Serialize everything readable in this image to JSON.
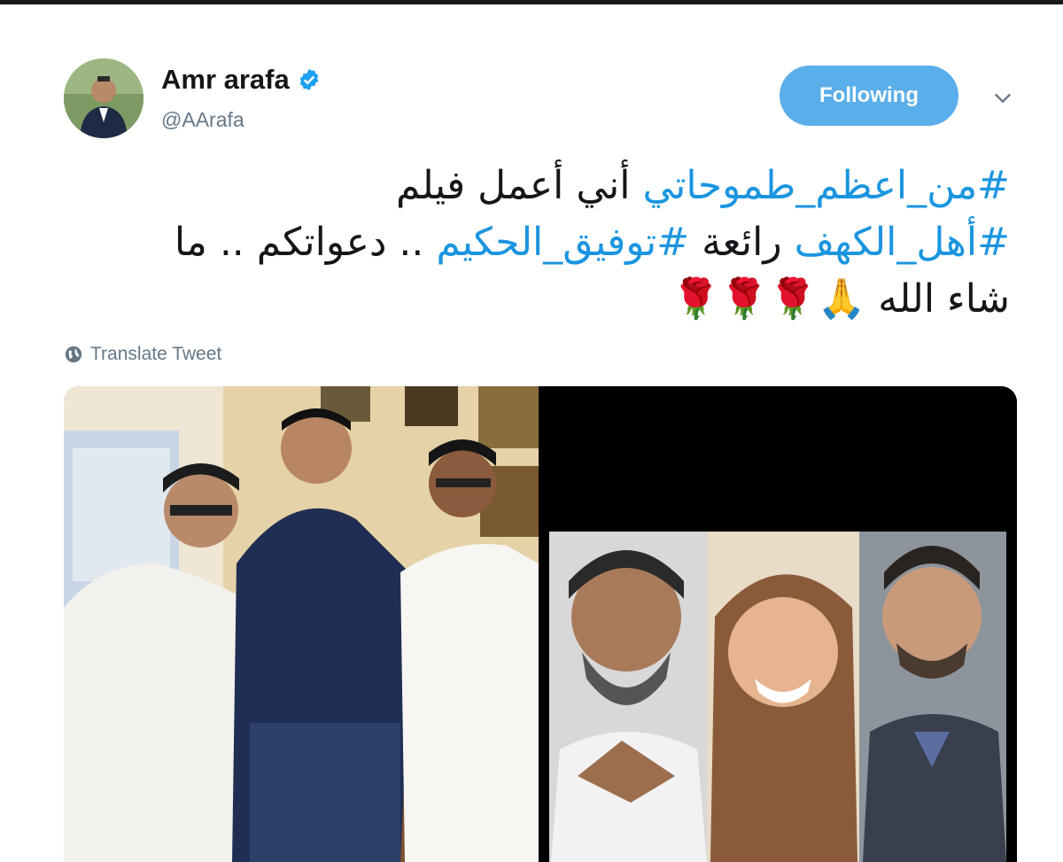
{
  "tweet": {
    "display_name": "Amr arafa",
    "handle": "@AArafa",
    "follow_label": "Following",
    "line1_hashtag": "#من_اعظم_طموحاتي",
    "line1_text": " أني أعمل فيلم",
    "line2_hashtag1": "#أهل_الكهف",
    "line2_text1": " رائعة ",
    "line2_hashtag2": "#توفيق_الحكيم",
    "line2_text2": " .. دعواتكم .. ما",
    "line3_text": "شاء الله 🙏🌹🌹🌹",
    "translate_label": "Translate Tweet"
  },
  "icons": {
    "verified": "verified-badge-icon",
    "chevron": "chevron-down-icon",
    "globe": "globe-icon"
  },
  "colors": {
    "accent": "#1b95e0",
    "follow_bg": "#5aaeea",
    "text": "#14171a",
    "muted": "#657786"
  }
}
